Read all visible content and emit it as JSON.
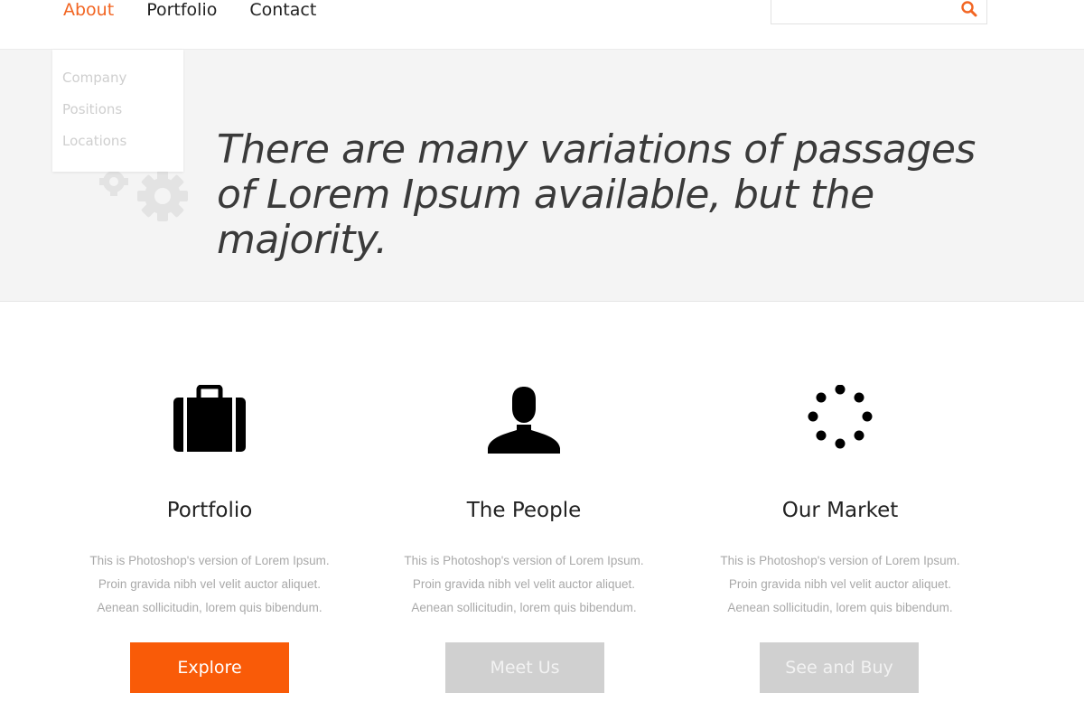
{
  "nav": {
    "items": [
      {
        "label": "About",
        "active": true
      },
      {
        "label": "Portfolio",
        "active": false
      },
      {
        "label": "Contact",
        "active": false
      }
    ]
  },
  "search": {
    "value": "",
    "placeholder": ""
  },
  "dropdown": {
    "items": [
      "Company",
      "Positions",
      "Locations"
    ]
  },
  "hero": {
    "text": "There are many variations of passages of Lorem Ipsum available, but the majority."
  },
  "features": [
    {
      "icon": "briefcase-icon",
      "title": "Portfolio",
      "lines": [
        "This is Photoshop's version  of Lorem Ipsum.",
        "Proin gravida nibh vel velit auctor aliquet.",
        "Aenean sollicitudin, lorem quis bibendum."
      ],
      "button": "Explore"
    },
    {
      "icon": "person-icon",
      "title": "The People",
      "lines": [
        "This is Photoshop's version  of Lorem Ipsum.",
        "Proin gravida nibh vel velit auctor aliquet.",
        "Aenean sollicitudin, lorem quis bibendum."
      ],
      "button": "Meet Us"
    },
    {
      "icon": "loading-dots-icon",
      "title": "Our Market",
      "lines": [
        "This is Photoshop's version  of Lorem Ipsum.",
        "Proin gravida nibh vel velit auctor aliquet.",
        "Aenean sollicitudin, lorem quis bibendum."
      ],
      "button": "See and Buy"
    }
  ],
  "colors": {
    "accent": "#f26522",
    "button_primary": "#f95b08",
    "button_muted": "#d0d0d0",
    "hero_bg": "#f4f4f4"
  }
}
